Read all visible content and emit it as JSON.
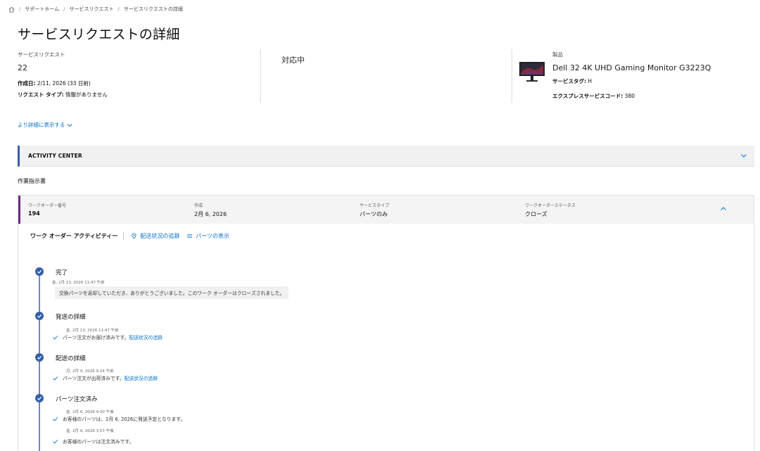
{
  "breadcrumb": {
    "items": [
      "サポートホーム",
      "サービスリクエスト",
      "サービスリクエストの詳細"
    ]
  },
  "page_title": "サービスリクエストの詳細",
  "request": {
    "label": "サービスリクエスト",
    "number": "22",
    "created_label": "作成日:",
    "created_value": "2/11, 2026 (33 日前)",
    "type_label": "リクエスト タイプ:",
    "type_value": "情報がありません"
  },
  "status": {
    "value": "対応中"
  },
  "product": {
    "label": "製品",
    "name": "Dell 32 4K UHD Gaming Monitor G3223Q",
    "service_tag_label": "サービスタグ:",
    "service_tag_value": "H",
    "express_label": "エクスプレスサービスコード:",
    "express_value": "380"
  },
  "more_link": "より詳細に表示する",
  "activity_center": {
    "title": "ACTIVITY CENTER"
  },
  "work_orders_label": "作業指示書",
  "work_order": {
    "number_header": "ワークオーダー番号",
    "number_value": "194",
    "created_header": "作成",
    "created_value": "2月 6, 2026",
    "service_type_header": "サービスタイプ",
    "service_type_value": "パーツのみ",
    "status_header": "ワークオーダーステータス",
    "status_value": "クローズ"
  },
  "tabs": {
    "active": "ワーク オーダー アクティビティー",
    "tracking": "配送状況の追跡",
    "parts": "パーツの表示"
  },
  "events": [
    {
      "title": "完了",
      "date": "金, 2月 13, 2026 11:47 午前",
      "message": "交換パーツを返却していただき、ありがとうございました。このワーク オーダーはクローズされました。"
    },
    {
      "title": "発送の詳細",
      "date": "金, 2月 13, 2026 11:47 午前",
      "message": "パーツ注文がお届け済みです。",
      "link": "配送状況の追跡"
    },
    {
      "title": "配送の詳細",
      "date": "月, 2月 9, 2026 9:24 午前",
      "message": "パーツ注文が出荷済みです。",
      "link": "配送状況の追跡"
    },
    {
      "title": "パーツ注文済み",
      "date1": "金, 2月 6, 2026 4:00 午後",
      "message1": "お客様のパーツは、2月 6, 2026に発送予定となります。",
      "date2": "金, 2月 6, 2026 3:57 午後",
      "message2": "お客様のパーツは注文済みです。"
    }
  ],
  "colors": {
    "link": "#0672cb",
    "timeline_node": "#3660a8",
    "activity_accent": "#3a5ea8",
    "work_order_accent": "#6e2a82"
  }
}
